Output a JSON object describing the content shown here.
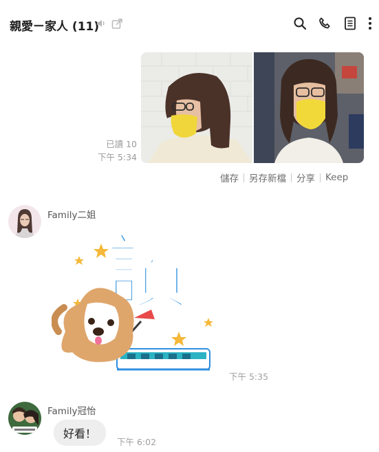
{
  "header": {
    "title": "親愛ㄧ家人 (11)",
    "icons": [
      "mute-icon",
      "external-link-icon",
      "search-icon",
      "phone-icon",
      "notes-icon",
      "more-icon"
    ]
  },
  "outgoing": {
    "read_status": "已讀 10",
    "time": "下午 5:34",
    "actions": [
      "儲存",
      "另存新檔",
      "分享",
      "Keep"
    ]
  },
  "messages": [
    {
      "sender": "Family二姐",
      "type": "sticker",
      "sticker_text": "讚",
      "time": "下午 5:35"
    },
    {
      "sender": "Family冠怡",
      "type": "text",
      "text": "好看！",
      "time": "下午 6:02"
    }
  ],
  "colors": {
    "accent_blue": "#2d8fe0",
    "bubble_bg": "#eeeeee",
    "time_gray": "#a0a0a0"
  }
}
